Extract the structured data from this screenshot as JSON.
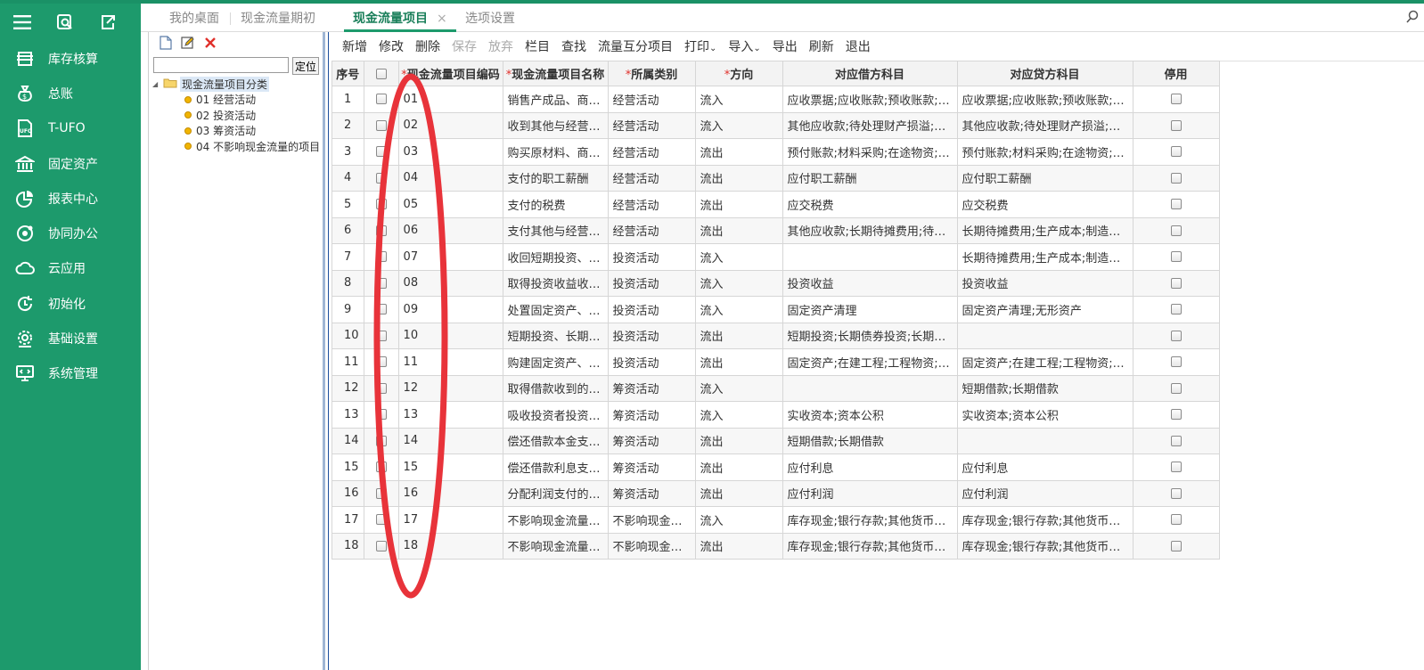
{
  "sidebar": {
    "items": [
      {
        "label": "库存核算",
        "icon": "warehouse-icon"
      },
      {
        "label": "总账",
        "icon": "money-bag-icon"
      },
      {
        "label": "T-UFO",
        "icon": "ufo-doc-icon"
      },
      {
        "label": "固定资产",
        "icon": "bank-icon"
      },
      {
        "label": "报表中心",
        "icon": "pie-chart-icon"
      },
      {
        "label": "协同办公",
        "icon": "collaboration-icon"
      },
      {
        "label": "云应用",
        "icon": "cloud-icon"
      },
      {
        "label": "初始化",
        "icon": "refresh-icon"
      },
      {
        "label": "基础设置",
        "icon": "gear-icon"
      },
      {
        "label": "系统管理",
        "icon": "monitor-code-icon"
      }
    ]
  },
  "tabs": [
    {
      "label": "我的桌面"
    },
    {
      "label": "现金流量期初"
    },
    {
      "label": "现金流量项目",
      "close": "×"
    },
    {
      "label": "选项设置"
    }
  ],
  "tree": {
    "search_button": "定位",
    "root": "现金流量项目分类",
    "children": [
      "01 经营活动",
      "02 投资活动",
      "03 筹资活动",
      "04 不影响现金流量的项目"
    ]
  },
  "toolbar": [
    "新增",
    "修改",
    "删除",
    "保存",
    "放弃",
    "栏目",
    "查找",
    "流量互分项目",
    "打印",
    "导入",
    "导出",
    "刷新",
    "退出"
  ],
  "grid": {
    "required_mark": "*",
    "headers": [
      "序号",
      "",
      "现金流量项目编码",
      "现金流量项目名称",
      "所属类别",
      "方向",
      "对应借方科目",
      "对应贷方科目",
      "停用"
    ],
    "rows": [
      [
        "1",
        "01",
        "销售产成品、商…",
        "经营活动",
        "流入",
        "应收票据;应收账款;预收账款;…",
        "应收票据;应收账款;预收账款;…"
      ],
      [
        "2",
        "02",
        "收到其他与经营…",
        "经营活动",
        "流入",
        "其他应收款;待处理财产损溢;…",
        "其他应收款;待处理财产损溢;…"
      ],
      [
        "3",
        "03",
        "购买原材料、商…",
        "经营活动",
        "流出",
        "预付账款;材料采购;在途物资;…",
        "预付账款;材料采购;在途物资;…"
      ],
      [
        "4",
        "04",
        "支付的职工薪酬",
        "经营活动",
        "流出",
        "应付职工薪酬",
        "应付职工薪酬"
      ],
      [
        "5",
        "05",
        "支付的税费",
        "经营活动",
        "流出",
        "应交税费",
        "应交税费"
      ],
      [
        "6",
        "06",
        "支付其他与经营…",
        "经营活动",
        "流出",
        "其他应收款;长期待摊费用;待…",
        "长期待摊费用;生产成本;制造…"
      ],
      [
        "7",
        "07",
        "收回短期投资、…",
        "投资活动",
        "流入",
        "",
        "长期待摊费用;生产成本;制造…"
      ],
      [
        "8",
        "08",
        "取得投资收益收…",
        "投资活动",
        "流入",
        "投资收益",
        "投资收益"
      ],
      [
        "9",
        "09",
        "处置固定资产、…",
        "投资活动",
        "流入",
        "固定资产清理",
        "固定资产清理;无形资产"
      ],
      [
        "10",
        "10",
        "短期投资、长期…",
        "投资活动",
        "流出",
        "短期投资;长期债券投资;长期…",
        ""
      ],
      [
        "11",
        "11",
        "购建固定资产、…",
        "投资活动",
        "流出",
        "固定资产;在建工程;工程物资;…",
        "固定资产;在建工程;工程物资;…"
      ],
      [
        "12",
        "12",
        "取得借款收到的…",
        "筹资活动",
        "流入",
        "",
        "短期借款;长期借款"
      ],
      [
        "13",
        "13",
        "吸收投资者投资…",
        "筹资活动",
        "流入",
        "实收资本;资本公积",
        "实收资本;资本公积"
      ],
      [
        "14",
        "14",
        "偿还借款本金支…",
        "筹资活动",
        "流出",
        "短期借款;长期借款",
        ""
      ],
      [
        "15",
        "15",
        "偿还借款利息支…",
        "筹资活动",
        "流出",
        "应付利息",
        "应付利息"
      ],
      [
        "16",
        "16",
        "分配利润支付的…",
        "筹资活动",
        "流出",
        "应付利润",
        "应付利润"
      ],
      [
        "17",
        "17",
        "不影响现金流量…",
        "不影响现金…",
        "流入",
        "库存现金;银行存款;其他货币…",
        "库存现金;银行存款;其他货币…"
      ],
      [
        "18",
        "18",
        "不影响现金流量…",
        "不影响现金…",
        "流出",
        "库存现金;银行存款;其他货币…",
        "库存现金;银行存款;其他货币…"
      ]
    ]
  },
  "colors": {
    "sidebar": "#1d9a6c",
    "accent": "#1a7f5a",
    "annotation": "#e8333a"
  }
}
